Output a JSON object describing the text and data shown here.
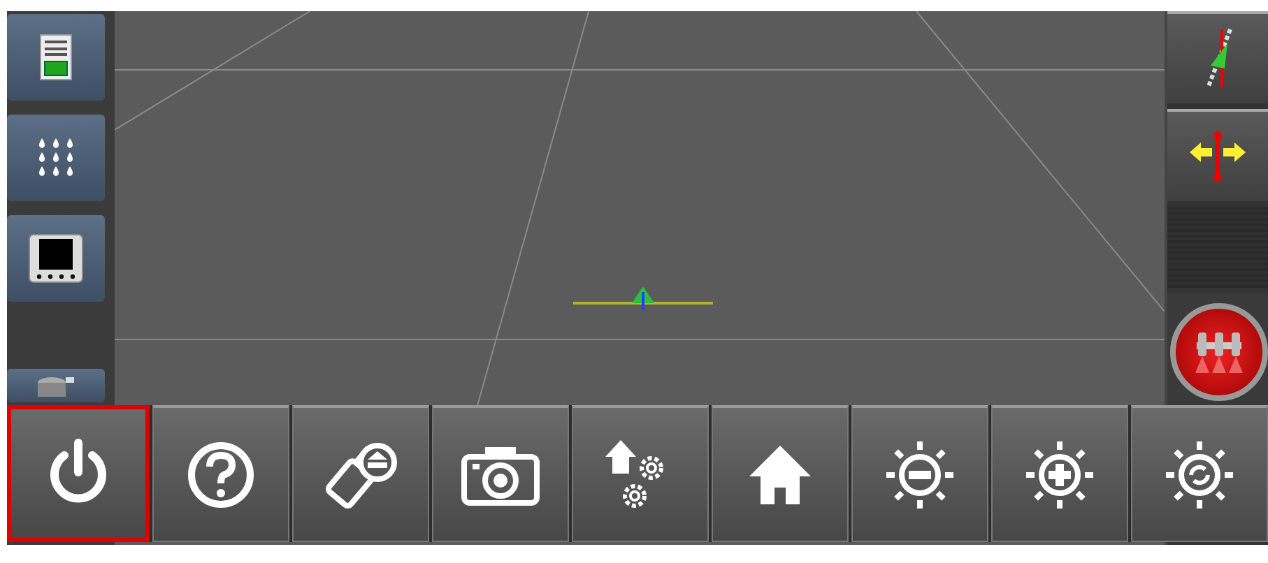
{
  "left_sidebar": {
    "items": [
      {
        "kind": "report"
      },
      {
        "kind": "nozzles"
      },
      {
        "kind": "display"
      },
      {
        "kind": "empty"
      },
      {
        "kind": "tank"
      }
    ]
  },
  "right_sidebar": {
    "items": [
      {
        "kind": "guidance"
      },
      {
        "kind": "nudge"
      },
      {
        "kind": "empty"
      },
      {
        "kind": "sections"
      }
    ]
  },
  "bottom_menu": {
    "items": [
      {
        "kind": "power",
        "selected": true
      },
      {
        "kind": "help",
        "selected": false
      },
      {
        "kind": "usb-eject",
        "selected": false
      },
      {
        "kind": "camera",
        "selected": false
      },
      {
        "kind": "home-settings",
        "selected": false
      },
      {
        "kind": "home",
        "selected": false
      },
      {
        "kind": "brightness-down",
        "selected": false
      },
      {
        "kind": "brightness-up",
        "selected": false
      },
      {
        "kind": "brightness-reset",
        "selected": false
      }
    ]
  }
}
